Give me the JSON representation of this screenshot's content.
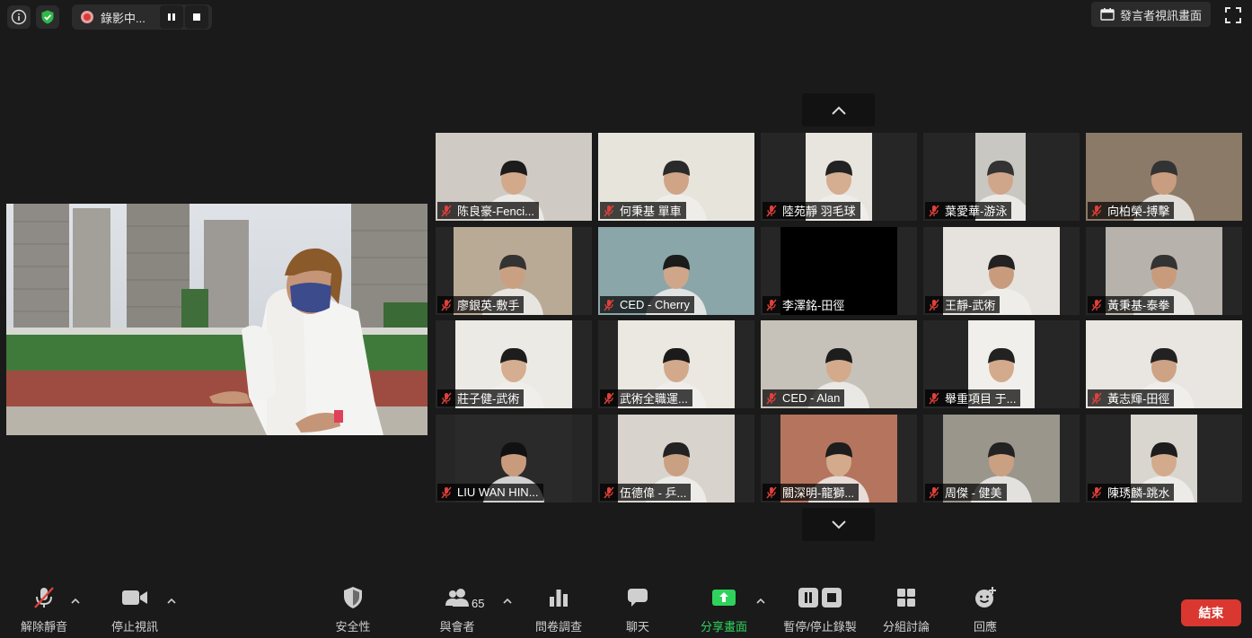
{
  "recording": {
    "status_label": "錄影中..."
  },
  "header": {
    "view_button_label": "發言者視訊畫面"
  },
  "participants": [
    {
      "name": "陈良豪-Fenci..."
    },
    {
      "name": "何秉基 單車"
    },
    {
      "name": "陸苑靜 羽毛球"
    },
    {
      "name": "葉愛華-游泳"
    },
    {
      "name": "向柏榮-搏擊"
    },
    {
      "name": "廖銀英-敷手"
    },
    {
      "name": "CED - Cherry"
    },
    {
      "name": "李澤銘-田徑"
    },
    {
      "name": "王靜-武術"
    },
    {
      "name": "黃秉基-泰拳"
    },
    {
      "name": "莊子健-武術"
    },
    {
      "name": "武術全職運..."
    },
    {
      "name": "CED - Alan"
    },
    {
      "name": "舉重項目 于..."
    },
    {
      "name": "黃志輝-田徑"
    },
    {
      "name": "LIU WAN HIN..."
    },
    {
      "name": "伍德偉 - 乒..."
    },
    {
      "name": "關深明-龍獅..."
    },
    {
      "name": "周傑 - 健美"
    },
    {
      "name": "陳琇麟-跳水"
    }
  ],
  "toolbar": {
    "unmute_label": "解除靜音",
    "stop_video_label": "停止視訊",
    "security_label": "安全性",
    "participants_label": "與會者",
    "participants_count": "65",
    "polls_label": "問卷調查",
    "chat_label": "聊天",
    "share_label": "分享畫面",
    "record_label": "暫停/停止錄製",
    "breakout_label": "分組討論",
    "reactions_label": "回應",
    "end_label": "結束"
  },
  "colors": {
    "share_green": "#2fd35c",
    "end_red": "#d9372f",
    "security_green": "#2fb84a"
  }
}
